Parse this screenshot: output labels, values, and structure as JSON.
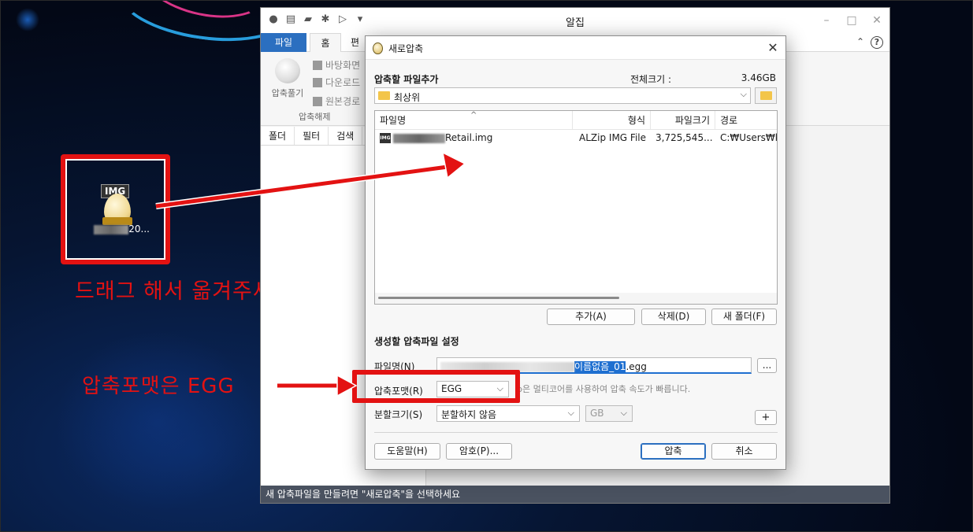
{
  "desktop": {
    "icon_tag": "IMG",
    "icon_label_suffix": "20...",
    "annotation_drag": "드래그 해서 옮겨주세요",
    "annotation_format": "압축포맷은 EGG"
  },
  "main_window": {
    "title": "알집",
    "ribbon_tabs": {
      "file": "파일",
      "home": "홈",
      "edit": "편"
    },
    "ribbon": {
      "big_button": "압축풀기",
      "small_items": [
        "바탕화면",
        "다운로드",
        "원본경로"
      ],
      "group_label": "압축해제"
    },
    "side_tabs": [
      "폴더",
      "필터",
      "검색"
    ],
    "status_text": "새 압축파일을 만들려면 \"새로압축\"을 선택하세요"
  },
  "dialog": {
    "title": "새로압축",
    "add_section_label": "압축할 파일추가",
    "total_size_label": "전체크기 :",
    "total_size_value": "3.46GB",
    "path_value": "최상위",
    "columns": {
      "name": "파일명",
      "type": "형식",
      "size": "파일크기",
      "path": "경로"
    },
    "files": [
      {
        "icon_tag": "IMG",
        "name": "Retail.img",
        "type": "ALZip IMG File",
        "size": "3,725,545...",
        "path": "C:₩Users₩kim"
      }
    ],
    "buttons": {
      "add": "추가(A)",
      "delete": "삭제(D)",
      "new_folder": "새 폴더(F)"
    },
    "create_section_label": "생성할 압축파일 설정",
    "filename_label": "파일명(N)",
    "filename_selected": "이름없음_01",
    "filename_ext": ".egg",
    "browse": "...",
    "format_label": "압축포맷(R)",
    "format_value": "EGG",
    "format_hint": "p은 멀티코어를 사용하여 압축 속도가 빠릅니다.",
    "split_label": "분할크기(S)",
    "split_value": "분할하지 않음",
    "split_unit": "GB",
    "plus": "+",
    "bottom_buttons": {
      "help": "도움말(H)",
      "password": "암호(P)...",
      "compress": "압축",
      "cancel": "취소"
    }
  }
}
